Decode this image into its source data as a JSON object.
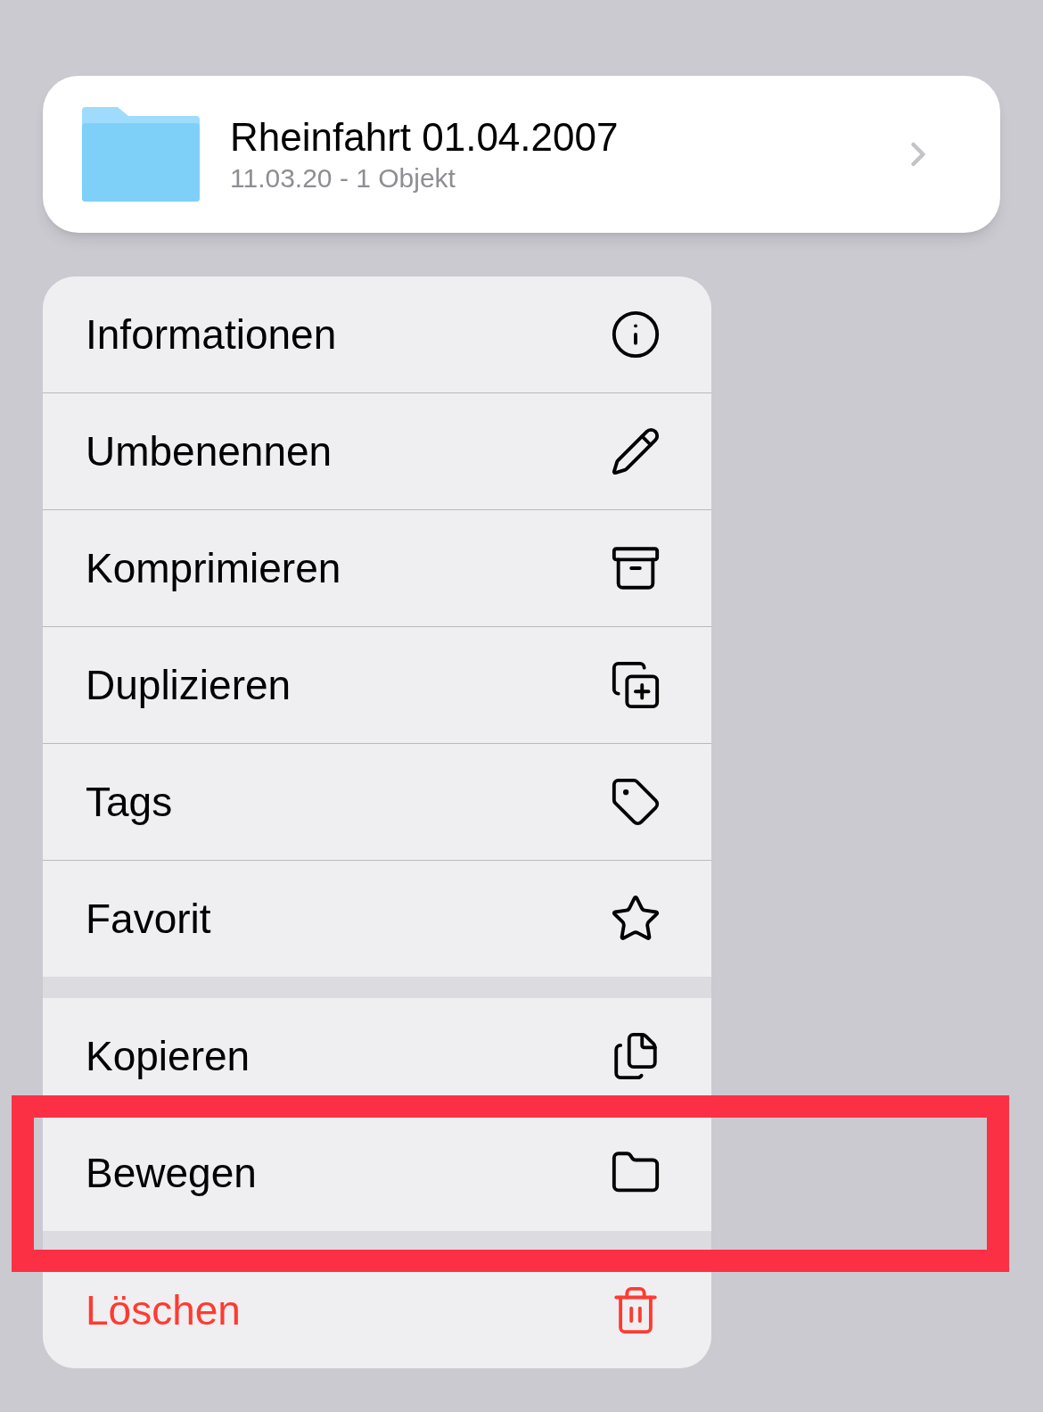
{
  "header": {
    "title": "Rheinfahrt 01.04.2007",
    "subtitle": "11.03.20 - 1 Objekt"
  },
  "menu": {
    "groups": [
      {
        "items": [
          {
            "label": "Informationen",
            "kind": "info",
            "destructive": false,
            "highlighted": false
          },
          {
            "label": "Umbenennen",
            "kind": "pencil",
            "destructive": false,
            "highlighted": false
          },
          {
            "label": "Komprimieren",
            "kind": "archive",
            "destructive": false,
            "highlighted": false
          },
          {
            "label": "Duplizieren",
            "kind": "duplicate",
            "destructive": false,
            "highlighted": false
          },
          {
            "label": "Tags",
            "kind": "tag",
            "destructive": false,
            "highlighted": false
          },
          {
            "label": "Favorit",
            "kind": "star",
            "destructive": false,
            "highlighted": false
          }
        ]
      },
      {
        "items": [
          {
            "label": "Kopieren",
            "kind": "copy",
            "destructive": false,
            "highlighted": false
          },
          {
            "label": "Bewegen",
            "kind": "folder",
            "destructive": false,
            "highlighted": true
          }
        ]
      },
      {
        "items": [
          {
            "label": "Löschen",
            "kind": "trash",
            "destructive": true,
            "highlighted": false
          }
        ]
      }
    ]
  }
}
